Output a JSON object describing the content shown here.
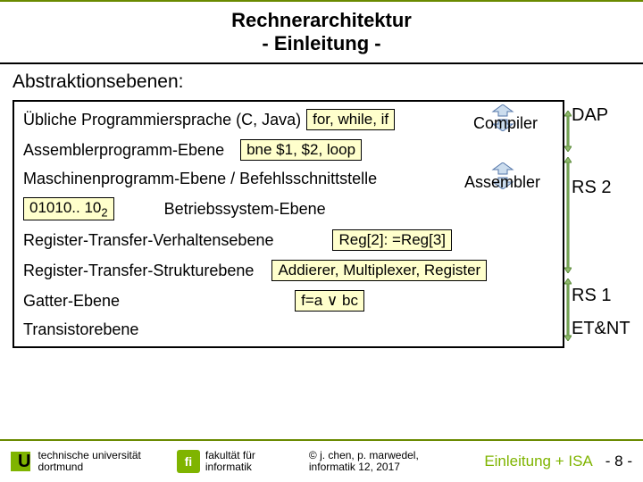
{
  "title": {
    "line1": "Rechnerarchitektur",
    "line2": "- Einleitung -"
  },
  "section_heading": "Abstraktionsebenen:",
  "rows": {
    "r1_label": "Übliche Programmiersprache (C, Java)",
    "r1_box": "for, while, if",
    "r2_label": "Assemblerprogramm-Ebene",
    "r2_box": "bne $1, $2, loop",
    "r3_label": "Maschinenprogramm-Ebene / Befehlsschnittstelle",
    "r4_box1": "01010.. 10",
    "r4_box1_sub": "2",
    "r4_label": "Betriebssystem-Ebene",
    "r5_label": "Register-Transfer-Verhaltensebene",
    "r5_box": "Reg[2]: =Reg[3]",
    "r6_label": "Register-Transfer-Strukturebene",
    "r6_box": "Addierer, Multiplexer, Register",
    "r7_label": "Gatter-Ebene",
    "r7_box": "f=a ∨ bc",
    "r8_label": "Transistorebene"
  },
  "translators": {
    "compiler": "Compiler",
    "assembler": "Assembler"
  },
  "side": {
    "dap": "DAP",
    "rs2": "RS 2",
    "rs1": "RS 1",
    "etnt": "ET&NT"
  },
  "footer": {
    "uni_l1": "technische universität",
    "uni_l2": "dortmund",
    "fak_l1": "fakultät für",
    "fak_l2": "informatik",
    "copy_l1": "© j. chen, p. marwedel,",
    "copy_l2": "informatik 12,  2017",
    "crumb": "Einleitung + ISA",
    "page": "- 8 -",
    "tu": "U",
    "fi": "fi"
  }
}
